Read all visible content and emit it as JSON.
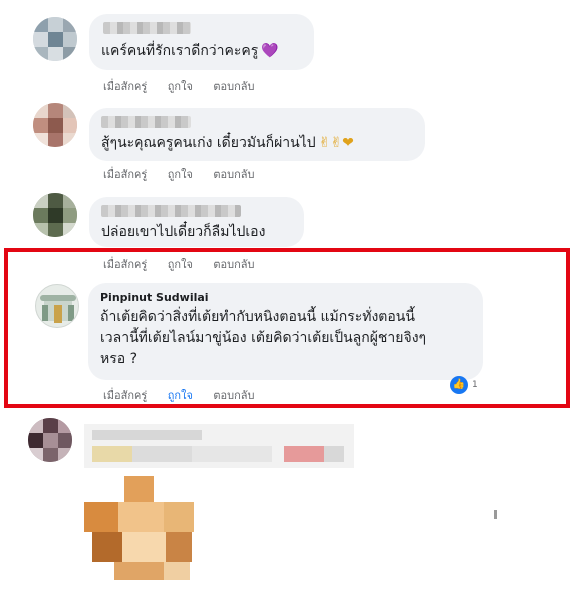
{
  "comments": [
    {
      "text": "แคร์คนที่รักเราดีกว่าคะครู",
      "emoji": "💜",
      "actions": {
        "reply_time": "เมื่อสักครู่",
        "like": "ถูกใจ",
        "reply": "ตอบกลับ"
      }
    },
    {
      "text": "สู้ๆนะคุณครูคนเก่ง เดี๋ยวมันก็ผ่านไป",
      "emoji": "✌✌❤",
      "actions": {
        "reply_time": "เมื่อสักครู่",
        "like": "ถูกใจ",
        "reply": "ตอบกลับ"
      }
    },
    {
      "text": "ปล่อยเขาไปเดี๋ยวก็ลืมไปเอง",
      "actions": {
        "reply_time": "เมื่อสักครู่",
        "like": "ถูกใจ",
        "reply": "ตอบกลับ"
      }
    },
    {
      "name": "Pinpinut Sudwilai",
      "lines": [
        "ถ้าเต้ยคิดว่าสิ่งที่เต้ยทำกับหนิงตอนนี้ แม้กระทั่งตอนนี้",
        "เวลานี้ที่เต้ยไลน์มาขู่น้อง เต้ยคิดว่าเต้ยเป็นลูกผู้ชายจิงๆ",
        "หรอ ?"
      ],
      "like_count": "1",
      "actions": {
        "reply_time": "เมื่อสักครู่",
        "like": "ถูกใจ",
        "reply": "ตอบกลับ"
      }
    }
  ],
  "colors": {
    "highlight_border": "#e30613",
    "bubble_bg": "#f0f2f5",
    "like_blue": "#1877f2",
    "meta_gray": "#65676b"
  },
  "icons": {
    "like_badge": "thumbs-up-icon"
  }
}
